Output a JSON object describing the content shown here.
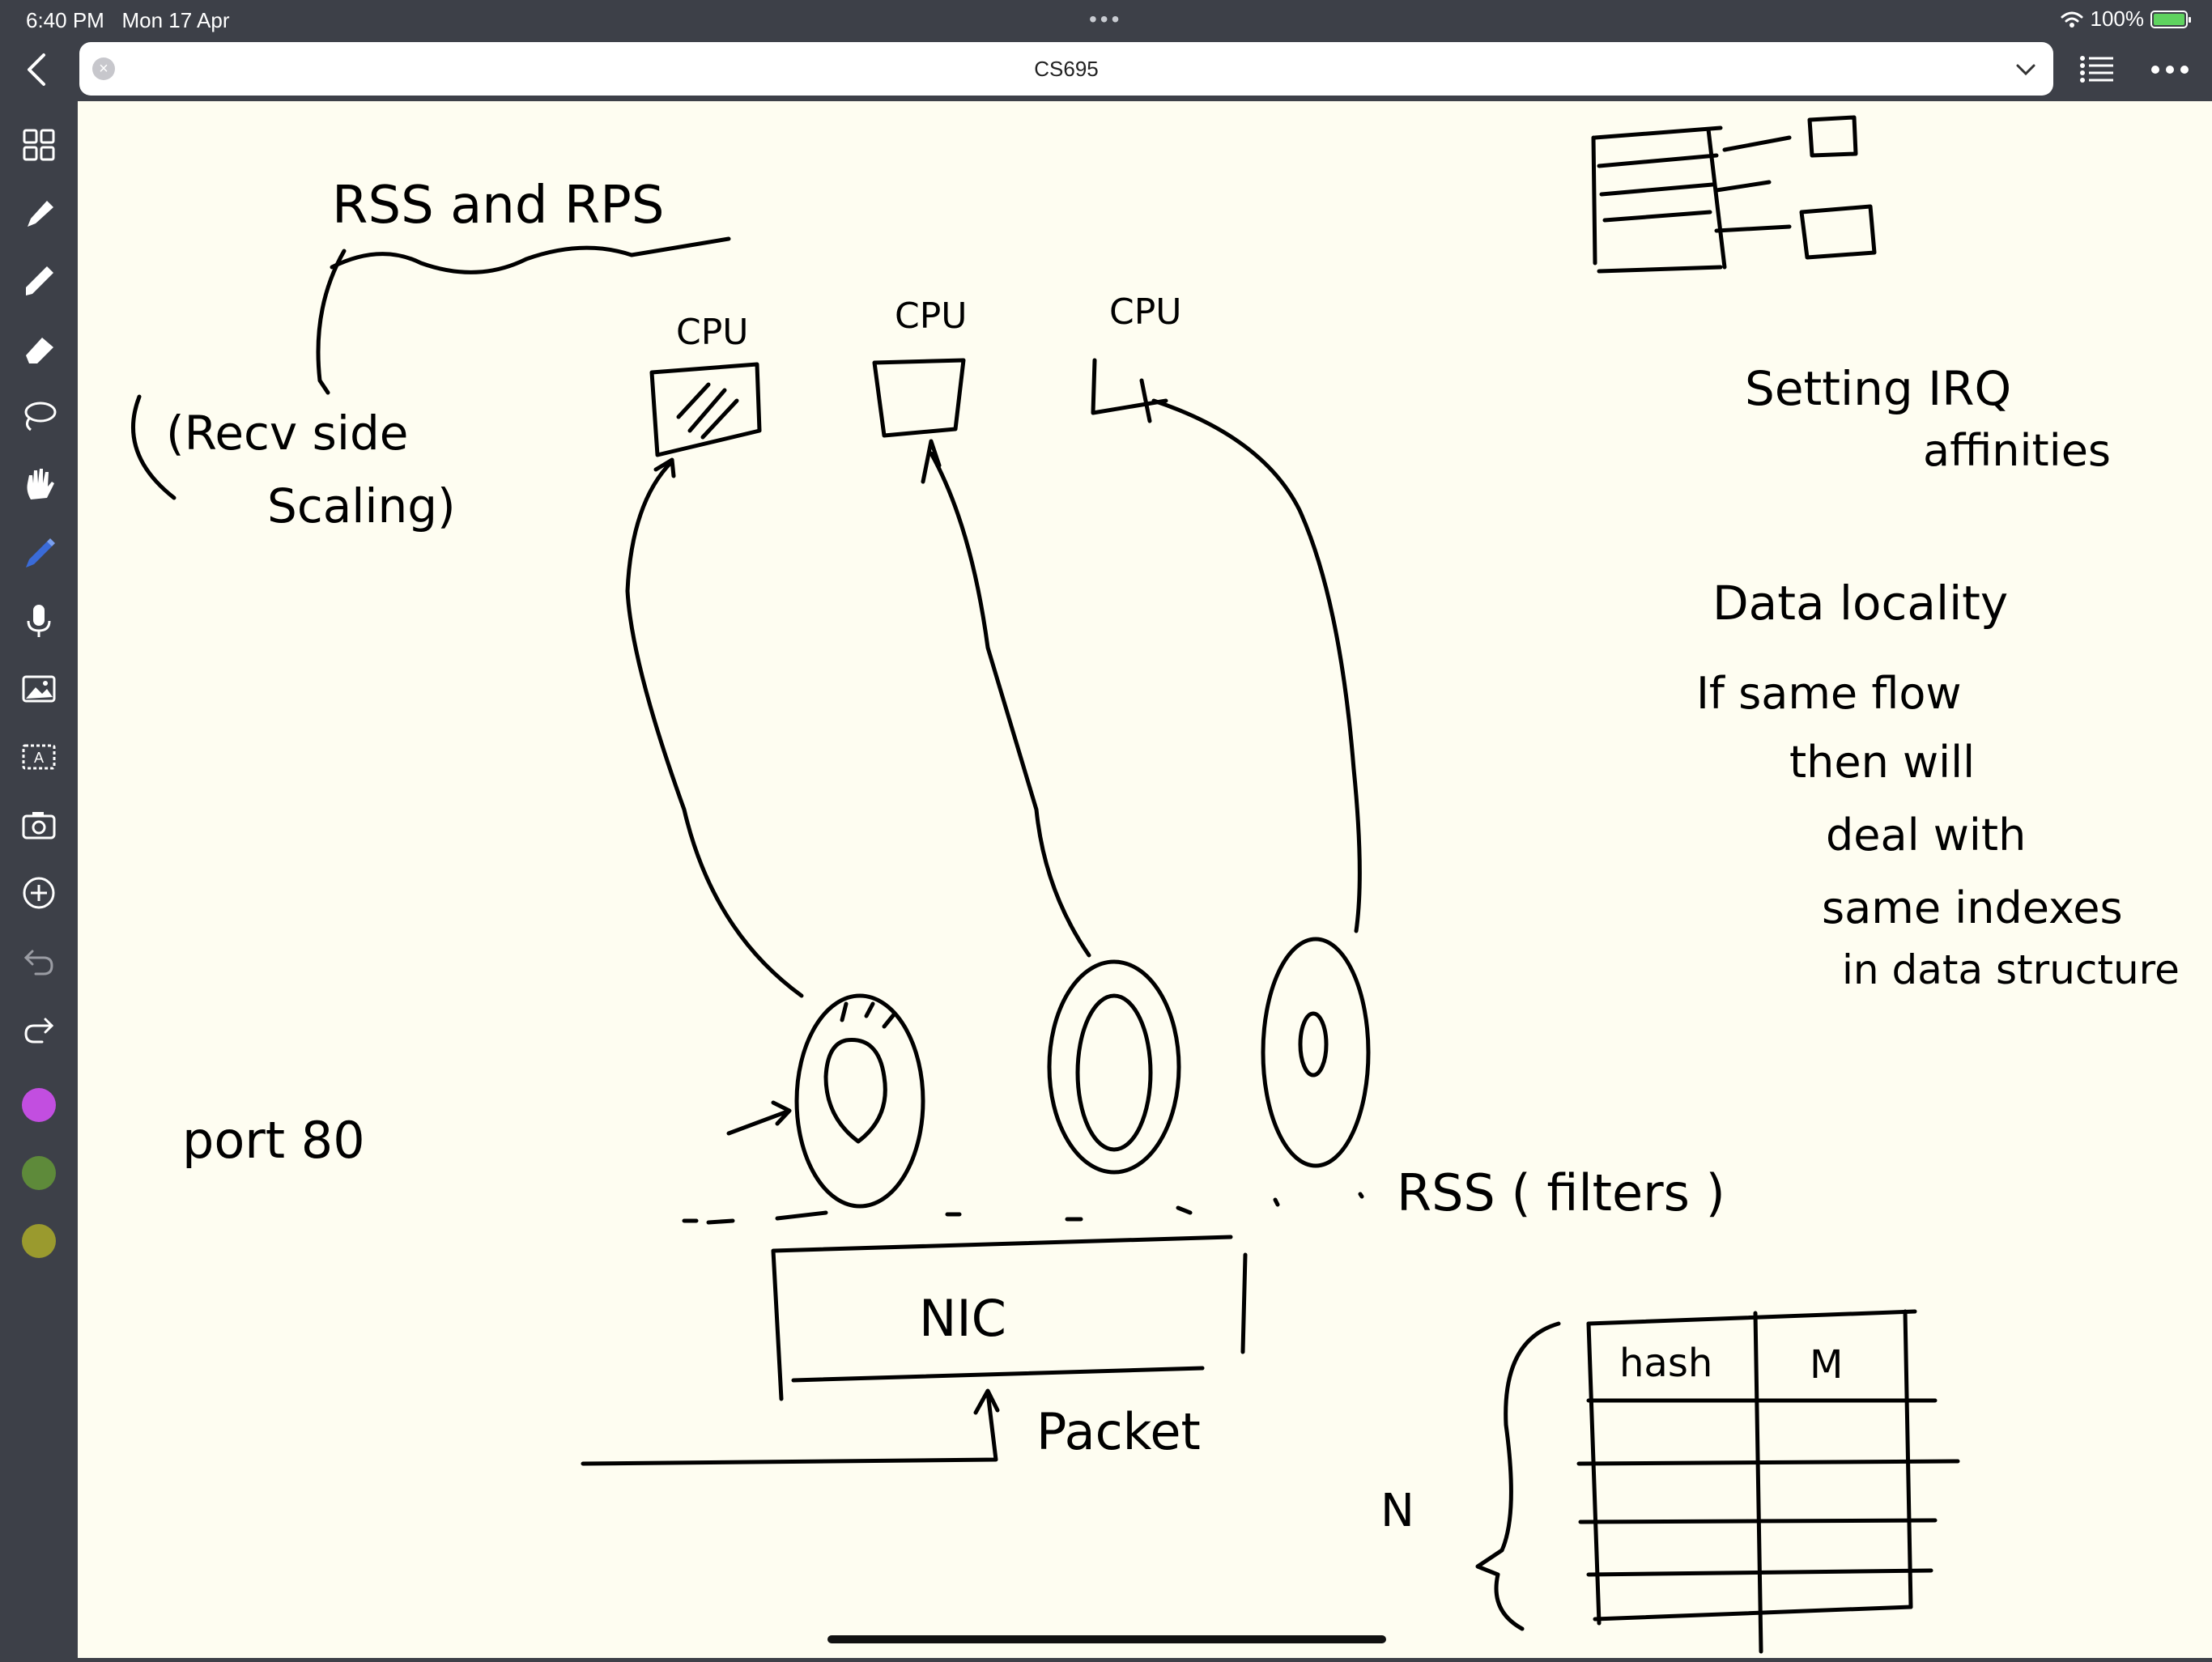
{
  "status_bar": {
    "time": "6:40 PM",
    "date": "Mon 17 Apr",
    "battery": "100%"
  },
  "document": {
    "title": "CS695"
  },
  "toolbar": {
    "tools": [
      "grid-icon",
      "pen-icon",
      "highlighter-icon",
      "eraser-icon",
      "lasso-icon",
      "hand-icon",
      "pencil-icon",
      "mic-icon",
      "image-icon",
      "text-box-icon",
      "camera-icon",
      "add-icon",
      "undo-icon",
      "redo-icon"
    ],
    "colors": [
      "#c24ee0",
      "#5e8a3a",
      "#9a9a2e"
    ]
  },
  "notes": {
    "heading": "RSS   and   RPS",
    "recv_side": "(Recv  side",
    "scaling": "Scaling)",
    "cpu_1": "CPU",
    "cpu_2": "CPU",
    "cpu_3": "CPU",
    "port": "port 80",
    "rss_filters": "RSS  ( filters )",
    "nic": "NIC",
    "packet": "Packet",
    "setting": "Setting  IRQ",
    "affinities": "affinities",
    "data_locality": "Data  locality",
    "line1": "If   same   flow",
    "line2": "then   will",
    "line3": "deal   with",
    "line4": "same   indexes",
    "line5": "in   data structure",
    "table_col_1": "hash",
    "table_col_2": "M",
    "n_label": "N"
  }
}
